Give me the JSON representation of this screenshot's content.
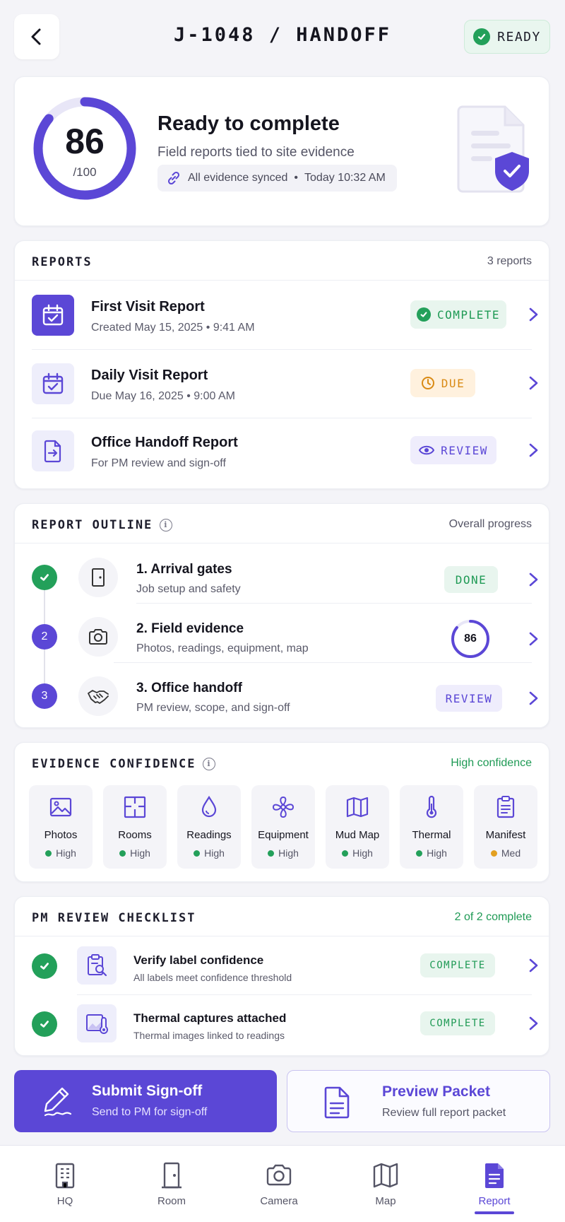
{
  "header": {
    "title": "J-1048 / HANDOFF",
    "ready_label": "READY"
  },
  "score": {
    "value": "86",
    "denominator": "/100",
    "fraction": 0.86,
    "title": "Ready to complete",
    "subtitle": "Field reports tied to site evidence",
    "sync_status": "All evidence synced",
    "sync_time": "Today 10:32 AM"
  },
  "reports": {
    "section_title": "REPORTS",
    "count_label": "3 reports",
    "items": [
      {
        "title": "First Visit Report",
        "subtitle": "Created May 15, 2025  •  9:41 AM",
        "status": "COMPLETE",
        "icon": "calendar-check-icon"
      },
      {
        "title": "Daily Visit Report",
        "subtitle": "Due May 16, 2025  •  9:00 AM",
        "status": "DUE",
        "icon": "calendar-check-icon"
      },
      {
        "title": "Office Handoff Report",
        "subtitle": "For PM review and sign-off",
        "status": "REVIEW",
        "icon": "file-export-icon"
      }
    ]
  },
  "outline": {
    "section_title": "REPORT OUTLINE",
    "right_label": "Overall progress",
    "steps": [
      {
        "marker": "",
        "title": "1. Arrival gates",
        "subtitle": "Job setup and safety",
        "status": "DONE",
        "icon": "door-icon"
      },
      {
        "marker": "2",
        "title": "2. Field evidence",
        "subtitle": "Photos, readings, equipment, map",
        "progress": "86",
        "progress_fraction": 0.86,
        "icon": "camera-icon"
      },
      {
        "marker": "3",
        "title": "3. Office handoff",
        "subtitle": "PM review, scope, and sign-off",
        "status": "REVIEW",
        "icon": "handshake-icon"
      }
    ]
  },
  "evidence": {
    "section_title": "EVIDENCE CONFIDENCE",
    "right_label": "High confidence",
    "tiles": [
      {
        "label": "Photos",
        "level": "High",
        "icon": "image-icon"
      },
      {
        "label": "Rooms",
        "level": "High",
        "icon": "floorplan-icon"
      },
      {
        "label": "Readings",
        "level": "High",
        "icon": "droplet-icon"
      },
      {
        "label": "Equipment",
        "level": "High",
        "icon": "fan-icon"
      },
      {
        "label": "Mud Map",
        "level": "High",
        "icon": "map-icon"
      },
      {
        "label": "Thermal",
        "level": "High",
        "icon": "thermometer-icon"
      },
      {
        "label": "Manifest",
        "level": "Med",
        "icon": "clipboard-icon"
      }
    ]
  },
  "checklist": {
    "section_title": "PM REVIEW CHECKLIST",
    "right_label": "2 of 2 complete",
    "items": [
      {
        "title": "Verify label confidence",
        "subtitle": "All labels meet confidence threshold",
        "status": "COMPLETE",
        "icon": "clipboard-search-icon"
      },
      {
        "title": "Thermal captures attached",
        "subtitle": "Thermal images linked to readings",
        "status": "COMPLETE",
        "icon": "thermal-image-icon"
      }
    ]
  },
  "actions": {
    "submit_title": "Submit Sign-off",
    "submit_sub": "Send to PM for sign-off",
    "preview_title": "Preview Packet",
    "preview_sub": "Review full report packet"
  },
  "nav": {
    "items": [
      {
        "label": "HQ",
        "icon": "building-icon"
      },
      {
        "label": "Room",
        "icon": "door-icon"
      },
      {
        "label": "Camera",
        "icon": "camera-icon"
      },
      {
        "label": "Map",
        "icon": "map-icon"
      },
      {
        "label": "Report",
        "icon": "report-icon",
        "active": true
      }
    ]
  },
  "colors": {
    "accent": "#5b47d6",
    "success": "#23a05a",
    "warning": "#d98a14",
    "background": "#f4f4f8"
  }
}
